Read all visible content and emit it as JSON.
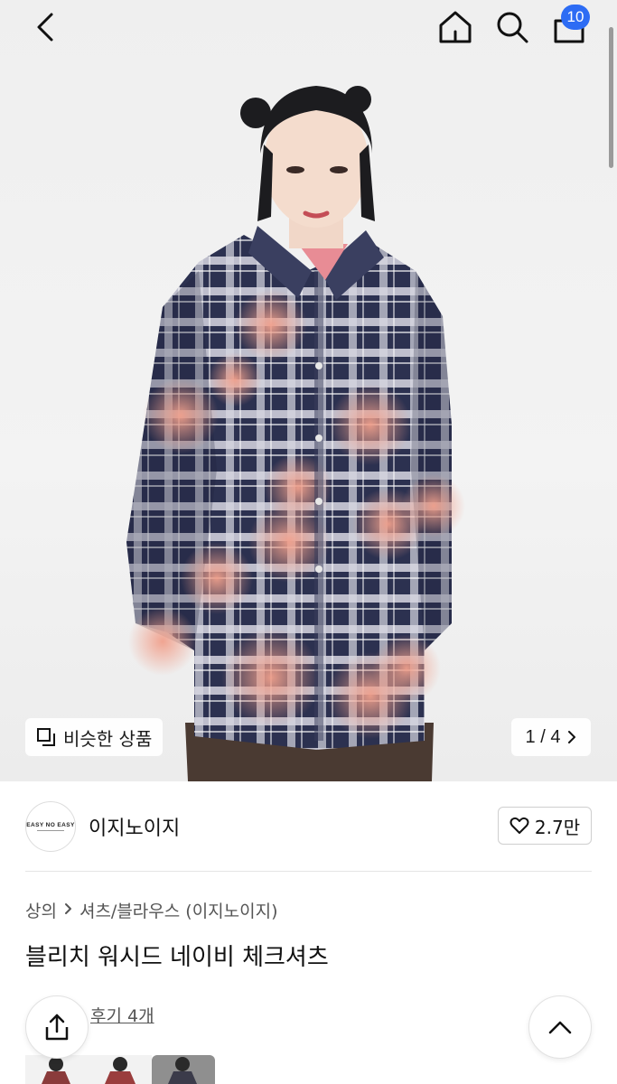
{
  "header": {
    "back_icon": "chevron-left-icon",
    "home_icon": "home-icon",
    "search_icon": "search-icon",
    "cart_icon": "shopping-bag-icon",
    "cart_count": "10",
    "badge_color": "#2d6cf4"
  },
  "gallery": {
    "similar_label": "비슷한 상품",
    "similar_icon": "copy-icon",
    "pager_text": "1 / 4",
    "pager_icon": "chevron-right-icon",
    "current_page": 1,
    "total_pages": 4
  },
  "brand": {
    "logo_text": "EASY NO EASY",
    "name": "이지노이지",
    "like_icon": "heart-icon",
    "like_count": "2.7만"
  },
  "product": {
    "breadcrumb": [
      "상의",
      "셔츠/블라우스 (이지노이지)"
    ],
    "title": "블리치 워시드 네이비 체크셔츠",
    "review_link": "후기 4개"
  },
  "fabs": {
    "share_icon": "share-icon",
    "scroll_top_icon": "chevron-up-icon"
  }
}
